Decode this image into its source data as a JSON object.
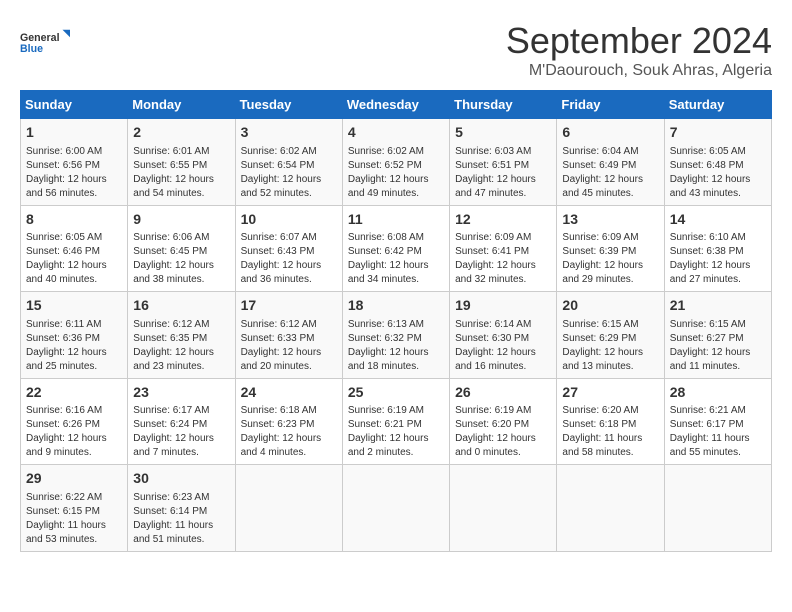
{
  "logo": {
    "line1": "General",
    "line2": "Blue"
  },
  "title": "September 2024",
  "location": "M'Daourouch, Souk Ahras, Algeria",
  "days_of_week": [
    "Sunday",
    "Monday",
    "Tuesday",
    "Wednesday",
    "Thursday",
    "Friday",
    "Saturday"
  ],
  "weeks": [
    [
      {
        "day": "1",
        "info": "Sunrise: 6:00 AM\nSunset: 6:56 PM\nDaylight: 12 hours\nand 56 minutes."
      },
      {
        "day": "2",
        "info": "Sunrise: 6:01 AM\nSunset: 6:55 PM\nDaylight: 12 hours\nand 54 minutes."
      },
      {
        "day": "3",
        "info": "Sunrise: 6:02 AM\nSunset: 6:54 PM\nDaylight: 12 hours\nand 52 minutes."
      },
      {
        "day": "4",
        "info": "Sunrise: 6:02 AM\nSunset: 6:52 PM\nDaylight: 12 hours\nand 49 minutes."
      },
      {
        "day": "5",
        "info": "Sunrise: 6:03 AM\nSunset: 6:51 PM\nDaylight: 12 hours\nand 47 minutes."
      },
      {
        "day": "6",
        "info": "Sunrise: 6:04 AM\nSunset: 6:49 PM\nDaylight: 12 hours\nand 45 minutes."
      },
      {
        "day": "7",
        "info": "Sunrise: 6:05 AM\nSunset: 6:48 PM\nDaylight: 12 hours\nand 43 minutes."
      }
    ],
    [
      {
        "day": "8",
        "info": "Sunrise: 6:05 AM\nSunset: 6:46 PM\nDaylight: 12 hours\nand 40 minutes."
      },
      {
        "day": "9",
        "info": "Sunrise: 6:06 AM\nSunset: 6:45 PM\nDaylight: 12 hours\nand 38 minutes."
      },
      {
        "day": "10",
        "info": "Sunrise: 6:07 AM\nSunset: 6:43 PM\nDaylight: 12 hours\nand 36 minutes."
      },
      {
        "day": "11",
        "info": "Sunrise: 6:08 AM\nSunset: 6:42 PM\nDaylight: 12 hours\nand 34 minutes."
      },
      {
        "day": "12",
        "info": "Sunrise: 6:09 AM\nSunset: 6:41 PM\nDaylight: 12 hours\nand 32 minutes."
      },
      {
        "day": "13",
        "info": "Sunrise: 6:09 AM\nSunset: 6:39 PM\nDaylight: 12 hours\nand 29 minutes."
      },
      {
        "day": "14",
        "info": "Sunrise: 6:10 AM\nSunset: 6:38 PM\nDaylight: 12 hours\nand 27 minutes."
      }
    ],
    [
      {
        "day": "15",
        "info": "Sunrise: 6:11 AM\nSunset: 6:36 PM\nDaylight: 12 hours\nand 25 minutes."
      },
      {
        "day": "16",
        "info": "Sunrise: 6:12 AM\nSunset: 6:35 PM\nDaylight: 12 hours\nand 23 minutes."
      },
      {
        "day": "17",
        "info": "Sunrise: 6:12 AM\nSunset: 6:33 PM\nDaylight: 12 hours\nand 20 minutes."
      },
      {
        "day": "18",
        "info": "Sunrise: 6:13 AM\nSunset: 6:32 PM\nDaylight: 12 hours\nand 18 minutes."
      },
      {
        "day": "19",
        "info": "Sunrise: 6:14 AM\nSunset: 6:30 PM\nDaylight: 12 hours\nand 16 minutes."
      },
      {
        "day": "20",
        "info": "Sunrise: 6:15 AM\nSunset: 6:29 PM\nDaylight: 12 hours\nand 13 minutes."
      },
      {
        "day": "21",
        "info": "Sunrise: 6:15 AM\nSunset: 6:27 PM\nDaylight: 12 hours\nand 11 minutes."
      }
    ],
    [
      {
        "day": "22",
        "info": "Sunrise: 6:16 AM\nSunset: 6:26 PM\nDaylight: 12 hours\nand 9 minutes."
      },
      {
        "day": "23",
        "info": "Sunrise: 6:17 AM\nSunset: 6:24 PM\nDaylight: 12 hours\nand 7 minutes."
      },
      {
        "day": "24",
        "info": "Sunrise: 6:18 AM\nSunset: 6:23 PM\nDaylight: 12 hours\nand 4 minutes."
      },
      {
        "day": "25",
        "info": "Sunrise: 6:19 AM\nSunset: 6:21 PM\nDaylight: 12 hours\nand 2 minutes."
      },
      {
        "day": "26",
        "info": "Sunrise: 6:19 AM\nSunset: 6:20 PM\nDaylight: 12 hours\nand 0 minutes."
      },
      {
        "day": "27",
        "info": "Sunrise: 6:20 AM\nSunset: 6:18 PM\nDaylight: 11 hours\nand 58 minutes."
      },
      {
        "day": "28",
        "info": "Sunrise: 6:21 AM\nSunset: 6:17 PM\nDaylight: 11 hours\nand 55 minutes."
      }
    ],
    [
      {
        "day": "29",
        "info": "Sunrise: 6:22 AM\nSunset: 6:15 PM\nDaylight: 11 hours\nand 53 minutes."
      },
      {
        "day": "30",
        "info": "Sunrise: 6:23 AM\nSunset: 6:14 PM\nDaylight: 11 hours\nand 51 minutes."
      },
      {
        "day": "",
        "info": ""
      },
      {
        "day": "",
        "info": ""
      },
      {
        "day": "",
        "info": ""
      },
      {
        "day": "",
        "info": ""
      },
      {
        "day": "",
        "info": ""
      }
    ]
  ]
}
